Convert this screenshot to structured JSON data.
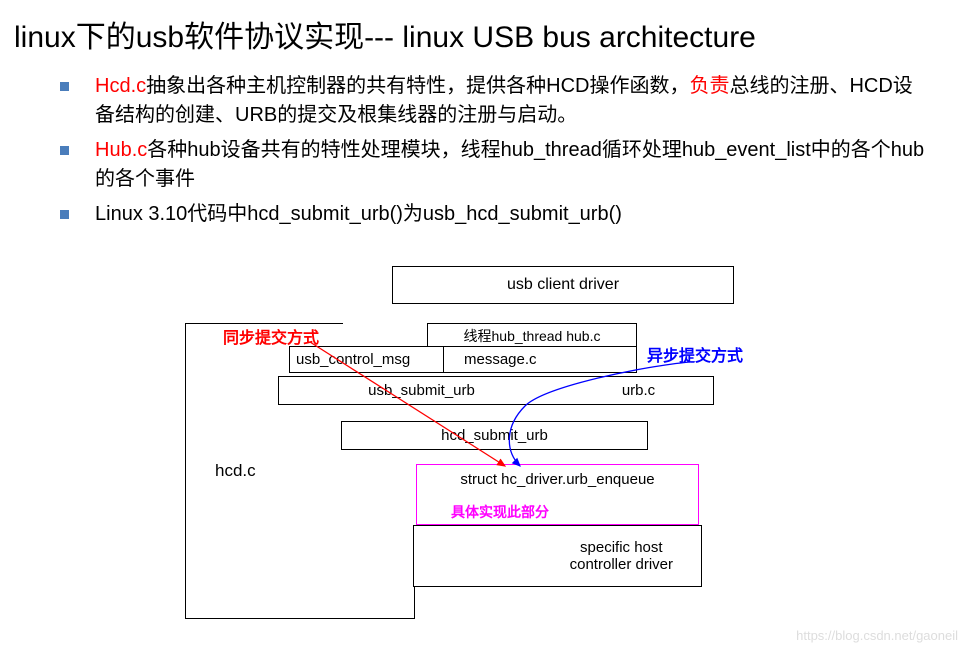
{
  "title": "linux下的usb软件协议实现--- linux USB bus architecture",
  "bullets": [
    {
      "parts": [
        {
          "text": "Hcd.c",
          "color": "red"
        },
        {
          "text": "抽象出各种主机控制器的共有特性，提供各种HCD操作函数，",
          "color": "black"
        },
        {
          "text": "负责",
          "color": "red"
        },
        {
          "text": "总线的注册、HCD设备结构的创建、URB的提交及根集线器的注册与启动。",
          "color": "black"
        }
      ]
    },
    {
      "parts": [
        {
          "text": "Hub.c",
          "color": "red"
        },
        {
          "text": "各种hub设备共有的特性处理模块，线程hub_thread循环处理hub_event_list中的各个hub的各个事件",
          "color": "black"
        }
      ]
    },
    {
      "parts": [
        {
          "text": "Linux 3.10代码中hcd_submit_urb()为usb_hcd_submit_urb()",
          "color": "black"
        }
      ]
    }
  ],
  "diagram": {
    "hcd_label": "hcd.c",
    "client_driver": "usb client driver",
    "hub_thread": "线程hub_thread hub.c",
    "usb_control_msg": "usb_control_msg",
    "message_c": "message.c",
    "usb_submit_urb": "usb_submit_urb",
    "urb_c": "urb.c",
    "hcd_submit_urb": "hcd_submit_urb",
    "struct_driver": "struct hc_driver.urb_enqueue",
    "impl_note": "具体实现此部分",
    "specific_host": "specific host\ncontroller driver",
    "sync_label": "同步提交方式",
    "async_label": "异步提交方式"
  },
  "watermark": "https://blog.csdn.net/gaoneil"
}
